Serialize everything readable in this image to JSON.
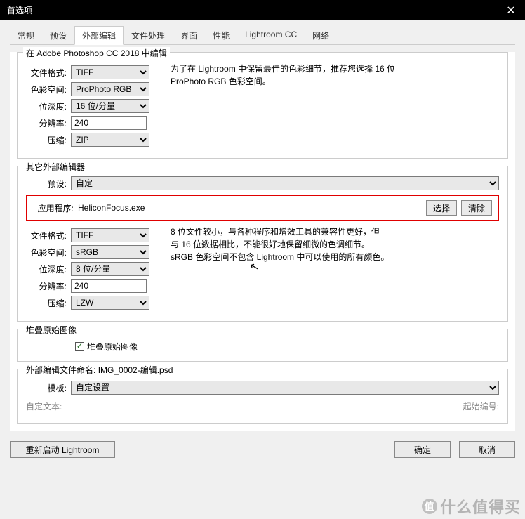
{
  "titlebar": {
    "title": "首选项"
  },
  "tabs": {
    "items": [
      {
        "label": "常规"
      },
      {
        "label": "预设"
      },
      {
        "label": "外部编辑"
      },
      {
        "label": "文件处理"
      },
      {
        "label": "界面"
      },
      {
        "label": "性能"
      },
      {
        "label": "Lightroom CC"
      },
      {
        "label": "网络"
      }
    ],
    "active_index": 2
  },
  "section_ps": {
    "title": "在 Adobe Photoshop CC 2018 中编辑",
    "file_format": {
      "label": "文件格式:",
      "value": "TIFF"
    },
    "color_space": {
      "label": "色彩空间:",
      "value": "ProPhoto RGB"
    },
    "bit_depth": {
      "label": "位深度:",
      "value": "16 位/分量"
    },
    "resolution": {
      "label": "分辨率:",
      "value": "240"
    },
    "compression": {
      "label": "压缩:",
      "value": "ZIP"
    },
    "hint": "为了在 Lightroom 中保留最佳的色彩细节，推荐您选择 16 位 ProPhoto RGB 色彩空间。"
  },
  "section_ext": {
    "title": "其它外部编辑器",
    "preset": {
      "label": "预设:",
      "value": "自定"
    },
    "application": {
      "label": "应用程序:",
      "value": "HeliconFocus.exe",
      "choose": "选择",
      "clear": "清除"
    },
    "file_format": {
      "label": "文件格式:",
      "value": "TIFF"
    },
    "color_space": {
      "label": "色彩空间:",
      "value": "sRGB"
    },
    "bit_depth": {
      "label": "位深度:",
      "value": "8 位/分量"
    },
    "resolution": {
      "label": "分辨率:",
      "value": "240"
    },
    "compression": {
      "label": "压缩:",
      "value": "LZW"
    },
    "hint1": "8 位文件较小，与各种程序和增效工具的兼容性更好，但",
    "hint2": "与 16 位数据相比，不能很好地保留细微的色调细节。",
    "hint3": "sRGB 色彩空间不包含 Lightroom 中可以使用的所有颜色。"
  },
  "section_stack": {
    "title": "堆叠原始图像",
    "checkbox_label": "堆叠原始图像",
    "checked": true
  },
  "section_naming": {
    "title_prefix": "外部编辑文件命名:",
    "title_value": "IMG_0002-编辑.psd",
    "template": {
      "label": "模板:",
      "value": "自定设置"
    },
    "custom_text": {
      "label": "自定文本:",
      "value": ""
    },
    "start_number": {
      "label": "起始编号:",
      "value": ""
    }
  },
  "footer": {
    "restart": "重新启动 Lightroom",
    "ok": "确定",
    "cancel": "取消"
  },
  "watermark": "什么值得买"
}
